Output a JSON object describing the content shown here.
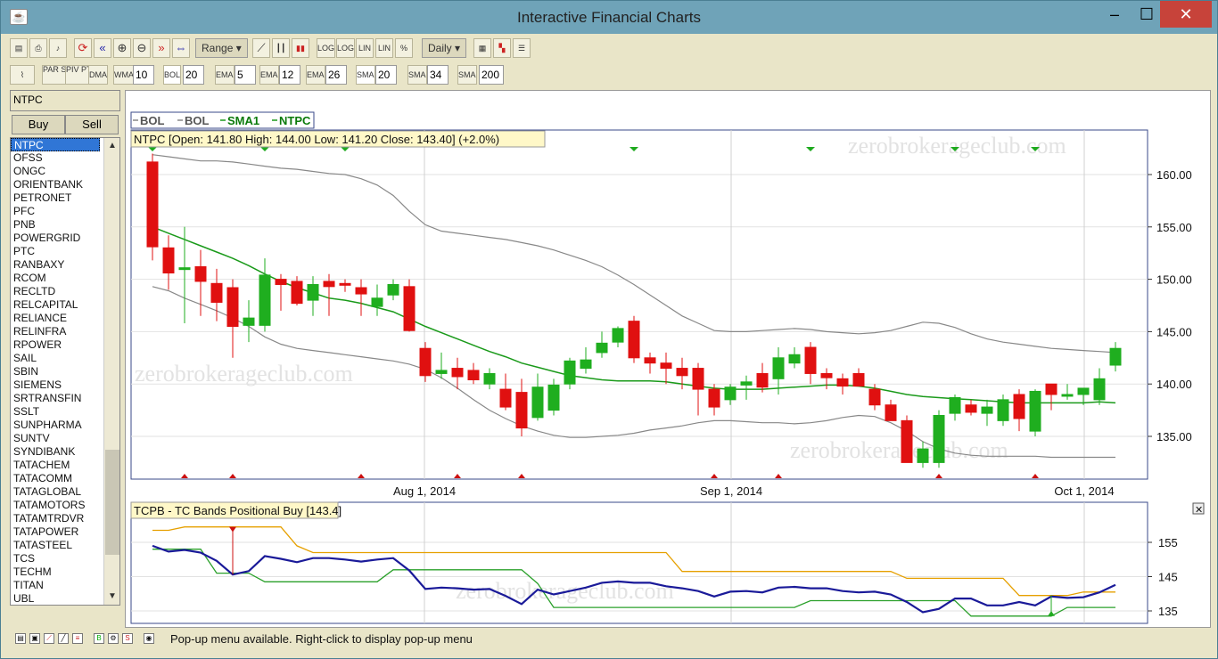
{
  "window": {
    "title": "Interactive Financial Charts"
  },
  "toolbar1": {
    "range_label": "Range",
    "period_label": "Daily",
    "icon_labels": [
      "LOG",
      "LOG",
      "LIN",
      "LIN",
      "%"
    ]
  },
  "toolbar2": {
    "buttons": [
      "PAR SAR",
      "PIV PTS",
      "DMA",
      "WMA",
      "BOL",
      "EMA",
      "EMA",
      "EMA",
      "SMA",
      "SMA",
      "SMA"
    ],
    "wma": "10",
    "bol": "20",
    "ema1": "5",
    "ema2": "12",
    "ema3": "26",
    "sma1": "20",
    "sma2": "34",
    "sma3": "200"
  },
  "sidebar": {
    "symbol": "NTPC",
    "buy_label": "Buy",
    "sell_label": "Sell",
    "symbols": [
      "NTPC",
      "OFSS",
      "ONGC",
      "ORIENTBANK",
      "PETRONET",
      "PFC",
      "PNB",
      "POWERGRID",
      "PTC",
      "RANBAXY",
      "RCOM",
      "RECLTD",
      "RELCAPITAL",
      "RELIANCE",
      "RELINFRA",
      "RPOWER",
      "SAIL",
      "SBIN",
      "SIEMENS",
      "SRTRANSFIN",
      "SSLT",
      "SUNPHARMA",
      "SUNTV",
      "SYNDIBANK",
      "TATACHEM",
      "TATACOMM",
      "TATAGLOBAL",
      "TATAMOTORS",
      "TATAMTRDVR",
      "TATAPOWER",
      "TATASTEEL",
      "TCS",
      "TECHM",
      "TITAN",
      "UBL"
    ]
  },
  "legend": {
    "items": [
      "BOL",
      "BOL",
      "SMA1",
      "NTPC"
    ]
  },
  "info_text": "NTPC [Open: 141.80  High: 144.00  Low: 141.20  Close: 143.40] (+2.0%)",
  "indicator_text": "TCPB - TC Bands Positional Buy [143.4]",
  "watermark": "zerobrokerageclub.com",
  "status_text": "Pop-up menu available. Right-click to display pop-up menu",
  "colors": {
    "up": "#1fae1f",
    "down": "#e01010",
    "sma": "#1a9a1a",
    "bol": "#888888",
    "ind_blue": "#1a1a99",
    "ind_orange": "#e6a000",
    "ind_green": "#2aa02a",
    "signal_green": "#1faa1f",
    "signal_red": "#cc1010"
  },
  "chart_data": [
    {
      "type": "candlestick",
      "title": "NTPC",
      "y_ticks": [
        "160.00",
        "155.00",
        "150.00",
        "145.00",
        "140.00",
        "135.00"
      ],
      "ylim": [
        132,
        164
      ],
      "x_ticks": [
        "Aug 1, 2014",
        "Sep 1, 2014",
        "Oct 1, 2014"
      ],
      "candles": [
        [
          161.2,
          162.0,
          151.8,
          153.1
        ],
        [
          153.0,
          154.2,
          149.0,
          150.6
        ],
        [
          151.0,
          155.0,
          145.8,
          151.1
        ],
        [
          151.2,
          152.8,
          146.5,
          149.8
        ],
        [
          149.6,
          151.0,
          146.0,
          147.8
        ],
        [
          149.2,
          150.0,
          142.5,
          145.5
        ],
        [
          145.6,
          148.0,
          144.0,
          146.3
        ],
        [
          145.6,
          152.0,
          145.0,
          150.4
        ],
        [
          150.0,
          150.5,
          147.0,
          149.5
        ],
        [
          149.8,
          150.3,
          147.5,
          147.7
        ],
        [
          148.0,
          150.3,
          146.5,
          149.5
        ],
        [
          149.8,
          150.5,
          146.5,
          149.3
        ],
        [
          149.6,
          150.0,
          148.8,
          149.5
        ],
        [
          149.2,
          150.0,
          146.5,
          148.6
        ],
        [
          147.4,
          149.5,
          146.5,
          148.2
        ],
        [
          148.5,
          150.0,
          148.0,
          149.5
        ],
        [
          149.3,
          150.0,
          145.0,
          145.1
        ],
        [
          143.4,
          144.0,
          140.2,
          140.8
        ],
        [
          141.0,
          143.0,
          140.5,
          141.3
        ],
        [
          141.5,
          142.5,
          139.5,
          140.7
        ],
        [
          141.3,
          142.0,
          140.0,
          140.4
        ],
        [
          140.0,
          141.5,
          139.5,
          141.0
        ],
        [
          139.5,
          141.0,
          137.5,
          137.8
        ],
        [
          139.2,
          140.5,
          135.0,
          135.8
        ],
        [
          136.8,
          141.0,
          136.5,
          139.7
        ],
        [
          137.5,
          140.5,
          137.0,
          139.9
        ],
        [
          140.0,
          142.5,
          139.5,
          142.2
        ],
        [
          141.5,
          143.5,
          141.0,
          142.3
        ],
        [
          143.0,
          145.0,
          142.5,
          143.9
        ],
        [
          144.0,
          145.5,
          143.5,
          145.3
        ],
        [
          146.0,
          146.5,
          142.0,
          142.5
        ],
        [
          142.5,
          143.0,
          141.0,
          142.0
        ],
        [
          142.0,
          143.0,
          140.0,
          141.5
        ],
        [
          141.5,
          142.5,
          139.5,
          140.8
        ],
        [
          141.5,
          142.0,
          137.0,
          139.5
        ],
        [
          139.5,
          140.0,
          137.0,
          137.8
        ],
        [
          138.5,
          140.0,
          138.0,
          139.7
        ],
        [
          139.9,
          140.8,
          138.5,
          140.2
        ],
        [
          141.0,
          142.0,
          139.2,
          139.7
        ],
        [
          140.5,
          143.5,
          139.0,
          142.5
        ],
        [
          142.0,
          143.5,
          141.5,
          142.8
        ],
        [
          143.5,
          144.0,
          140.0,
          141.0
        ],
        [
          141.0,
          141.5,
          139.5,
          140.6
        ],
        [
          140.5,
          141.0,
          139.0,
          139.8
        ],
        [
          141.0,
          141.5,
          139.8,
          139.8
        ],
        [
          139.5,
          140.0,
          137.5,
          138.0
        ],
        [
          138.0,
          138.5,
          136.5,
          136.5
        ],
        [
          136.5,
          137.0,
          132.5,
          132.5
        ],
        [
          132.5,
          134.5,
          132.0,
          133.8
        ],
        [
          132.5,
          137.5,
          132.0,
          137.0
        ],
        [
          137.2,
          139.0,
          136.5,
          138.7
        ],
        [
          138.0,
          138.5,
          137.0,
          137.3
        ],
        [
          137.2,
          138.5,
          136.0,
          137.8
        ],
        [
          136.5,
          139.0,
          136.0,
          138.5
        ],
        [
          139.0,
          139.5,
          135.5,
          136.7
        ],
        [
          135.5,
          139.5,
          135.0,
          139.3
        ],
        [
          140.0,
          140.0,
          137.5,
          139.0
        ],
        [
          139.0,
          140.0,
          138.5,
          139.0
        ],
        [
          139.0,
          139.5,
          138.0,
          139.6
        ],
        [
          138.5,
          141.5,
          138.0,
          140.5
        ],
        [
          141.8,
          144.0,
          141.2,
          143.4
        ]
      ],
      "sma1": [
        155.0,
        154.4,
        153.8,
        153.2,
        152.6,
        152.0,
        151.3,
        150.5,
        149.8,
        149.2,
        148.7,
        148.2,
        148.0,
        147.7,
        147.3,
        146.9,
        146.2,
        145.5,
        144.9,
        144.3,
        143.7,
        143.1,
        142.6,
        142.0,
        141.6,
        141.2,
        140.8,
        140.6,
        140.4,
        140.3,
        140.3,
        140.3,
        140.2,
        140.0,
        139.8,
        139.6,
        139.5,
        139.5,
        139.5,
        139.6,
        139.7,
        139.8,
        139.9,
        139.9,
        139.8,
        139.6,
        139.3,
        139.0,
        138.8,
        138.7,
        138.6,
        138.5,
        138.4,
        138.3,
        138.2,
        138.2,
        138.2,
        138.2,
        138.2,
        138.3,
        138.2
      ],
      "bol_upper": [
        161.9,
        161.7,
        161.5,
        161.3,
        161.3,
        161.2,
        161.0,
        160.8,
        160.6,
        160.5,
        160.3,
        160.1,
        160.0,
        159.6,
        159.0,
        158.0,
        156.5,
        155.2,
        154.6,
        154.4,
        154.2,
        154.0,
        153.8,
        153.5,
        153.2,
        152.8,
        152.3,
        151.8,
        151.2,
        150.4,
        149.5,
        148.5,
        147.5,
        146.5,
        145.8,
        145.1,
        145.0,
        145.0,
        145.1,
        145.2,
        145.3,
        145.2,
        145.0,
        144.9,
        144.8,
        144.9,
        145.1,
        145.5,
        145.9,
        145.8,
        145.4,
        144.8,
        144.3,
        144.0,
        143.8,
        143.6,
        143.4,
        143.3,
        143.2,
        143.1,
        143.0
      ],
      "bol_lower": [
        149.3,
        148.9,
        148.2,
        147.6,
        147.0,
        146.3,
        145.5,
        144.5,
        143.8,
        143.4,
        143.2,
        143.0,
        142.8,
        142.6,
        142.4,
        142.2,
        141.9,
        141.4,
        140.6,
        139.6,
        138.5,
        137.5,
        136.7,
        136.0,
        135.5,
        135.1,
        134.9,
        134.9,
        135.0,
        135.1,
        135.3,
        135.6,
        135.8,
        136.0,
        136.3,
        136.5,
        136.5,
        136.4,
        136.3,
        136.3,
        136.2,
        136.3,
        136.5,
        136.8,
        137.0,
        136.9,
        136.3,
        135.5,
        134.5,
        133.8,
        133.4,
        133.2,
        133.1,
        133.1,
        133.1,
        133.1,
        133.0,
        133.0,
        133.0,
        133.0,
        133.0
      ],
      "buy_signals_index": [
        0,
        7,
        12,
        30,
        41,
        50,
        55
      ],
      "sell_signals_index": [
        2,
        5,
        13,
        19,
        23,
        35,
        39,
        49,
        55
      ]
    },
    {
      "type": "line",
      "title": "TCPB - TC Bands Positional Buy [143.4]",
      "y_ticks": [
        "155",
        "145",
        "135"
      ],
      "ylim": [
        132,
        161
      ],
      "series": [
        {
          "values": [
            154.0,
            152.3,
            152.8,
            152.0,
            149.6,
            145.6,
            146.6,
            151.0,
            150.2,
            149.2,
            150.4,
            150.4,
            150.0,
            149.4,
            150.0,
            150.4,
            146.8,
            141.4,
            141.8,
            141.6,
            141.2,
            141.4,
            139.4,
            137.0,
            141.2,
            139.8,
            140.8,
            141.8,
            143.2,
            143.6,
            143.2,
            143.2,
            142.2,
            141.6,
            140.8,
            139.2,
            140.6,
            140.8,
            140.4,
            141.8,
            142.0,
            141.6,
            141.6,
            140.8,
            140.4,
            140.6,
            139.8,
            137.6,
            134.6,
            135.6,
            138.6,
            138.6,
            136.6,
            136.6,
            137.6,
            136.6,
            139.2,
            138.8,
            139.0,
            140.4,
            142.6
          ]
        },
        {
          "values": [
            158.5,
            158.5,
            159.5,
            159.5,
            159.5,
            159.5,
            159.5,
            159.5,
            159.5,
            154.0,
            152.0,
            152.0,
            152.0,
            152.0,
            152.0,
            152.0,
            152.0,
            152.0,
            152.0,
            152.0,
            152.0,
            152.0,
            152.0,
            152.0,
            152.0,
            152.0,
            152.0,
            152.0,
            152.0,
            152.0,
            152.0,
            152.0,
            152.0,
            146.5,
            146.5,
            146.5,
            146.5,
            146.5,
            146.5,
            146.5,
            146.5,
            146.5,
            146.5,
            146.5,
            146.5,
            146.5,
            146.5,
            144.5,
            144.5,
            144.5,
            144.5,
            144.5,
            144.5,
            144.5,
            139.5,
            139.5,
            139.5,
            139.5,
            140.5,
            140.5,
            140.5
          ]
        },
        {
          "values": [
            153.0,
            153.0,
            153.0,
            153.0,
            146.0,
            146.0,
            146.0,
            143.5,
            143.5,
            143.5,
            143.5,
            143.5,
            143.5,
            143.5,
            143.5,
            147.0,
            147.0,
            147.0,
            147.0,
            147.0,
            147.0,
            147.0,
            147.0,
            147.0,
            143.0,
            136.0,
            136.0,
            136.0,
            136.0,
            136.0,
            136.0,
            136.0,
            136.0,
            136.0,
            136.0,
            136.0,
            136.0,
            136.0,
            136.0,
            136.0,
            136.0,
            138.0,
            138.0,
            138.0,
            138.0,
            138.0,
            138.0,
            138.0,
            138.0,
            138.0,
            138.0,
            133.5,
            133.5,
            133.5,
            133.5,
            133.5,
            133.5,
            136.0,
            136.0,
            136.0,
            136.0
          ]
        }
      ]
    }
  ]
}
